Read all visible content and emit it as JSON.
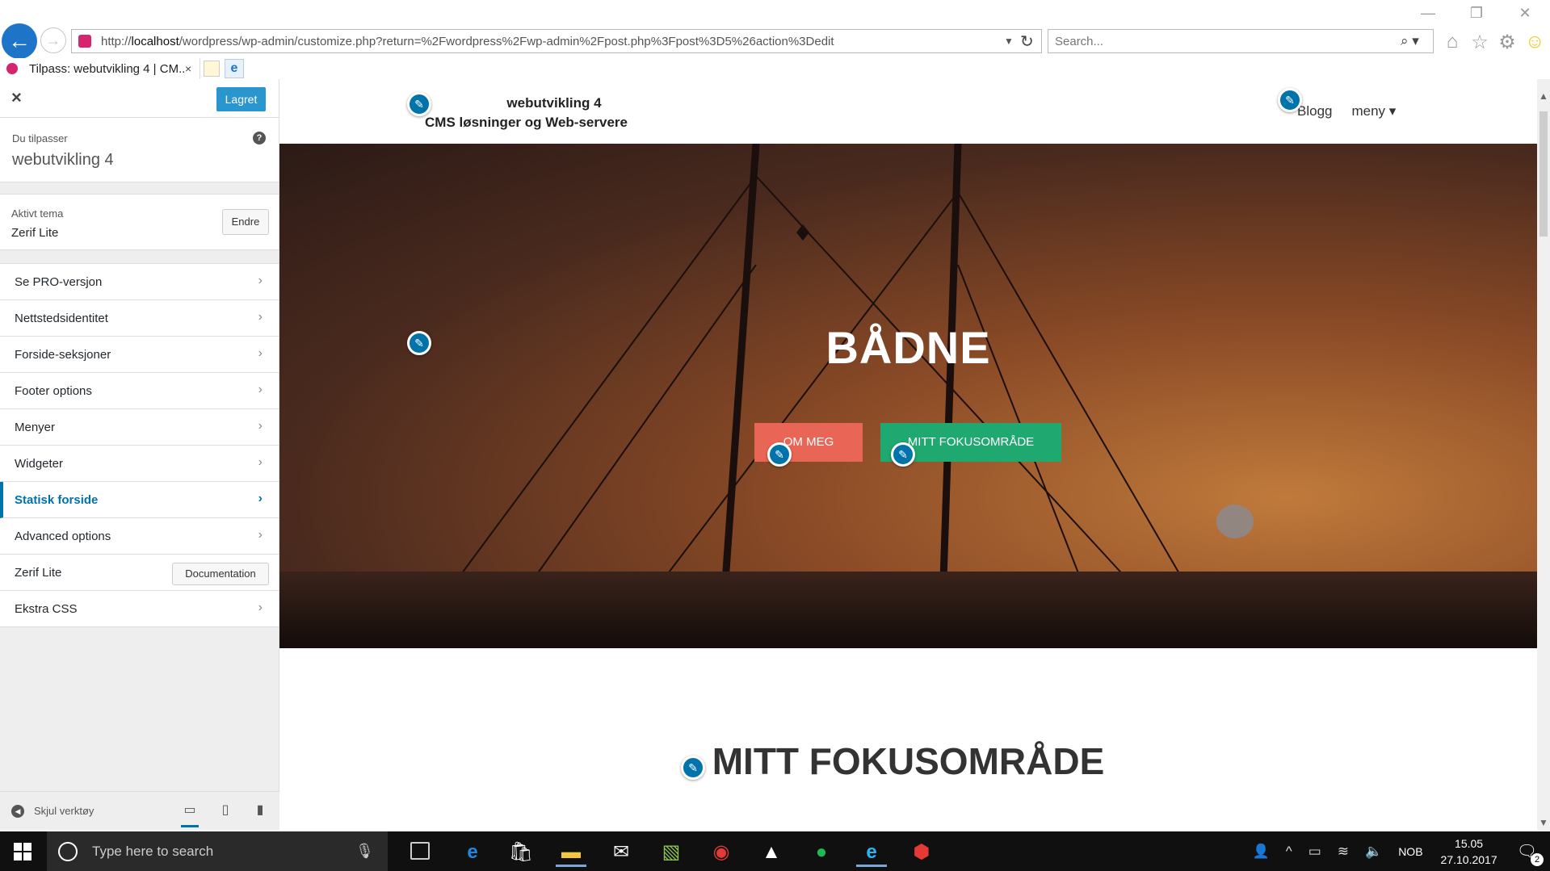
{
  "browser": {
    "url_prefix": "http://",
    "url_host": "localhost",
    "url_path": "/wordpress/wp-admin/customize.php?return=%2Fwordpress%2Fwp-admin%2Fpost.php%3Fpost%3D5%26action%3Dedit",
    "search_placeholder": "Search...",
    "tab_title": "Tilpass: webutvikling 4 | CM...",
    "tab_close": "×",
    "win_controls": [
      "—",
      "❐",
      "✕"
    ],
    "tools": [
      "⌂",
      "☆",
      "⚙",
      "☺"
    ]
  },
  "customizer": {
    "close_label": "×",
    "save_label": "Lagret",
    "info_label": "Du tilpasser",
    "site_name": "webutvikling 4",
    "help_label": "?",
    "theme_label": "Aktivt tema",
    "theme_name": "Zerif Lite",
    "theme_change": "Endre",
    "sections": [
      {
        "label": "Se PRO-versjon"
      },
      {
        "label": "Nettstedsidentitet"
      },
      {
        "label": "Forside-seksjoner"
      },
      {
        "label": "Footer options"
      },
      {
        "label": "Menyer"
      },
      {
        "label": "Widgeter"
      },
      {
        "label": "Statisk forside"
      },
      {
        "label": "Advanced options"
      }
    ],
    "docs_label": "Zerif Lite",
    "docs_button": "Documentation",
    "extra_css": "Ekstra CSS",
    "hide_controls": "Skjul verktøy"
  },
  "preview": {
    "site_title": "webutvikling 4",
    "tagline": "CMS løsninger og Web-servere",
    "nav": [
      "Blogg",
      "meny ▾"
    ],
    "hero_title": "BÅDNE",
    "hero_btn_1": "OM MEG",
    "hero_btn_2": "MITT FOKUSOMRÅDE",
    "focus_title": "MITT FOKUSOMRÅDE"
  },
  "taskbar": {
    "search_placeholder": "Type here to search",
    "language": "NOB",
    "time": "15.05",
    "date": "27.10.2017",
    "notifications": "2"
  },
  "colors": {
    "accent": "#0073aa",
    "save": "#2a96d0",
    "hero_btn_red": "#e96656",
    "hero_btn_green": "#1fa971"
  }
}
